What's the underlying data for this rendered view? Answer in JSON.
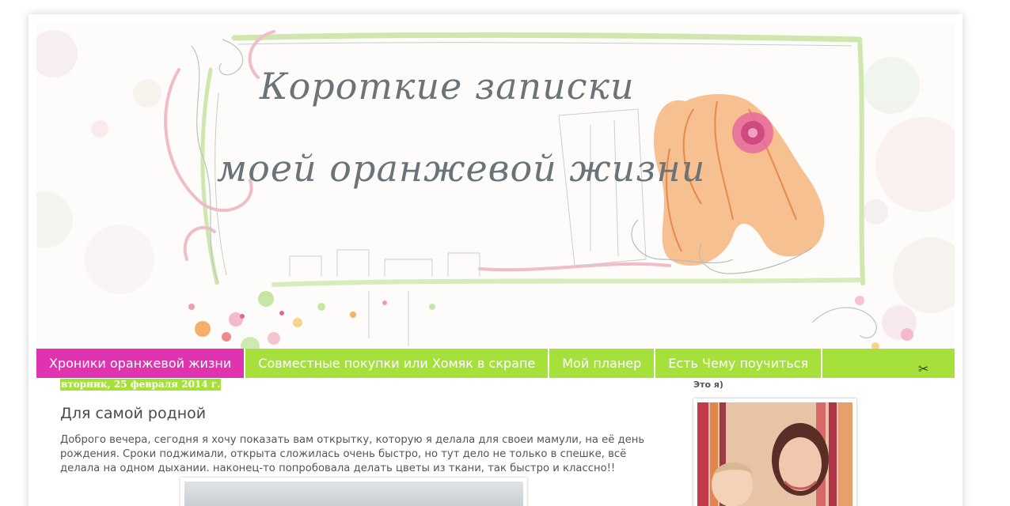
{
  "header": {
    "title_line1": "Короткие записки",
    "title_line2": "моей оранжевой жизни"
  },
  "nav": {
    "items": [
      {
        "label": "Хроники оранжевой жизни",
        "active": true
      },
      {
        "label": "Совместные покупки или Хомяк в скрапе",
        "active": false
      },
      {
        "label": "Мой планер",
        "active": false
      },
      {
        "label": "Есть Чему поучиться",
        "active": false
      }
    ],
    "tool_icon": "scissors-icon"
  },
  "post": {
    "date": "вторник, 25 февраля 2014 г.",
    "title": "Для самой родной",
    "body": "Доброго вечера, сегодня я хочу показать вам открытку, которую я делала для своеи мамули, на её день рождения. Сроки поджимали, открыта сложилась очень быстро, но тут дело не только в спешке, всё делала на одном дыхании. наконец-то попробовала делать цветы из ткани, так быстро и классно!!"
  },
  "sidebar": {
    "profile_title": "Это я)"
  },
  "colors": {
    "nav_green": "#a6e03a",
    "nav_active_pink": "#e033b0",
    "title_gray": "#6a7478",
    "hair_orange": "#f2a05c"
  }
}
